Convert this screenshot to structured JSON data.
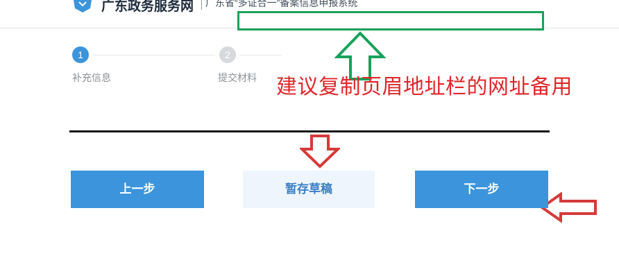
{
  "header": {
    "site_name": "广东政务服务网",
    "system_name": "广东省“多证合一”备案信息申报系统"
  },
  "steps": [
    {
      "number": "1",
      "label": "补充信息"
    },
    {
      "number": "2",
      "label": "提交材料"
    }
  ],
  "annotation": {
    "note": "建议复制页眉地址栏的网址备用",
    "note_color": "#e0262a",
    "highlight_color": "#19a15a"
  },
  "buttons": {
    "prev": "上一步",
    "draft": "暂存草稿",
    "next": "下一步"
  },
  "colors": {
    "accent": "#3b94dc",
    "draft_bg": "#eef5fd"
  }
}
